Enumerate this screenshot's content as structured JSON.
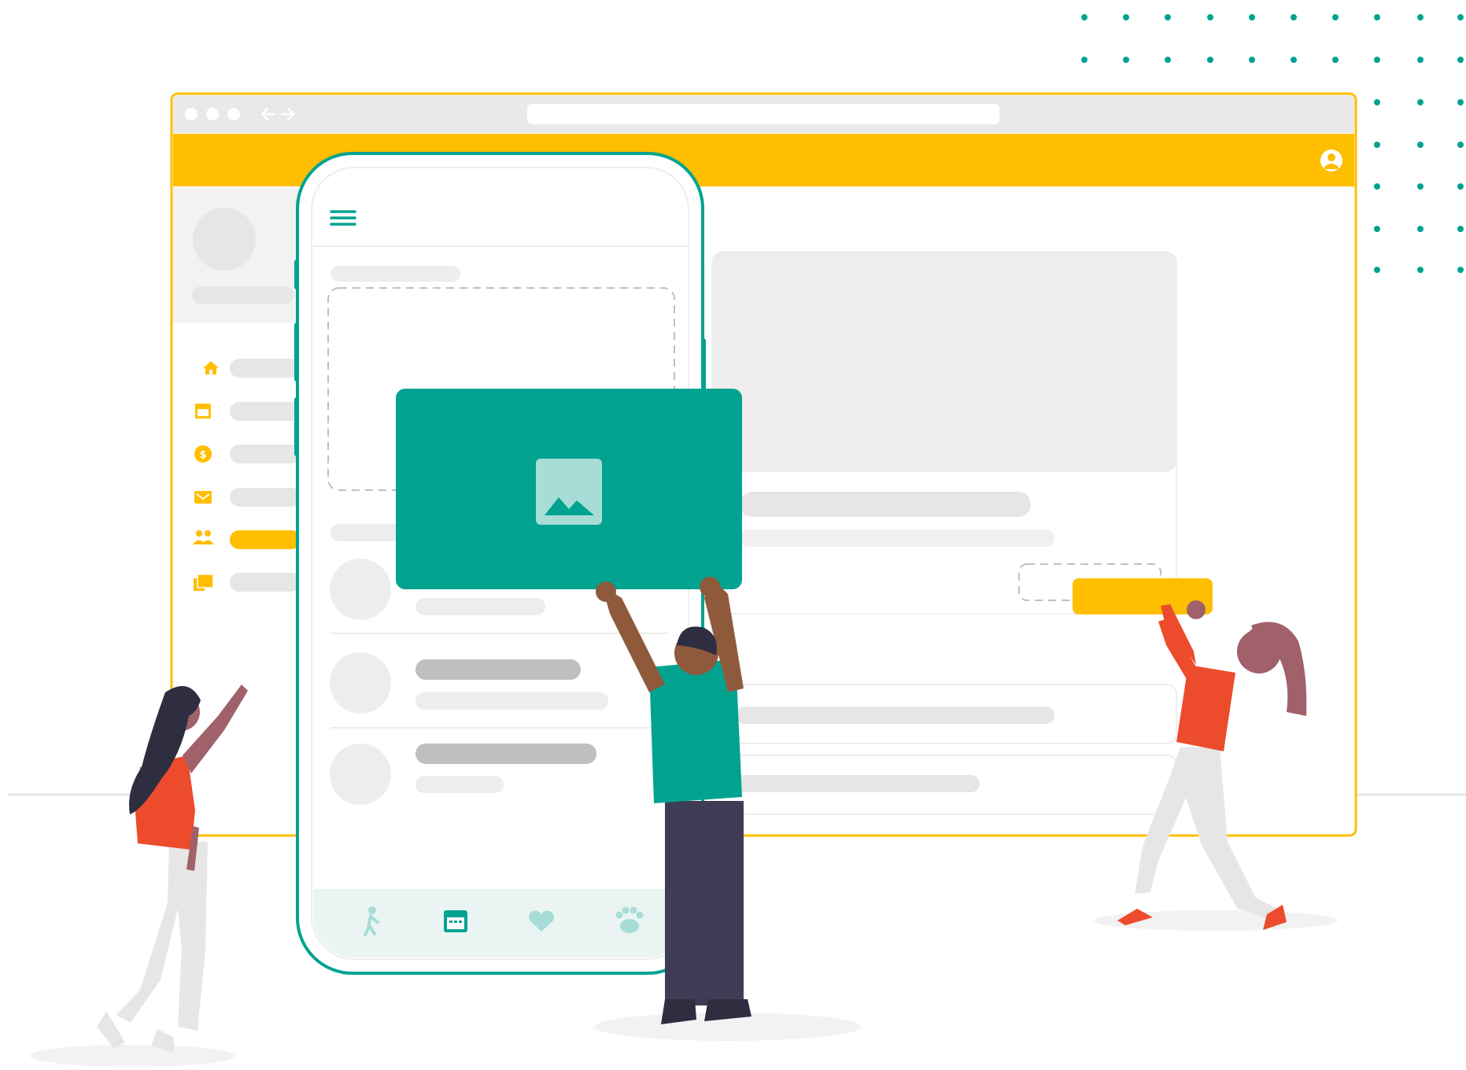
{
  "colors": {
    "accent_yellow": "#FFBE00",
    "teal": "#01A390",
    "teal_light": "#A7DDD6",
    "placeholder_grey": "#E6E6E6",
    "placeholder_dark": "#BFBFBF",
    "panel_grey": "#F2F2F2",
    "skin_dark": "#2F2E41",
    "shirt_red": "#EC4C2C",
    "hair_brown": "#A0616A",
    "pants_grey": "#E0E0E0",
    "pants_dark": "#3F3D56"
  },
  "browser": {
    "window_dots": 3,
    "nav_icons": [
      "arrow-left-icon",
      "arrow-right-icon"
    ],
    "header_icon": "user-account-icon",
    "sidebar_icons": [
      "home-icon",
      "calendar-icon",
      "dollar-icon",
      "mail-icon",
      "people-icon",
      "gallery-icon"
    ],
    "active_sidebar_index": 4
  },
  "phone": {
    "menu_icon": "hamburger-menu-icon",
    "list_rows": 3,
    "bottom_nav_icons": [
      "walking-person-icon",
      "calendar-icon",
      "heart-icon",
      "paw-icon"
    ]
  },
  "image_card": {
    "icon": "image-placeholder-icon"
  }
}
